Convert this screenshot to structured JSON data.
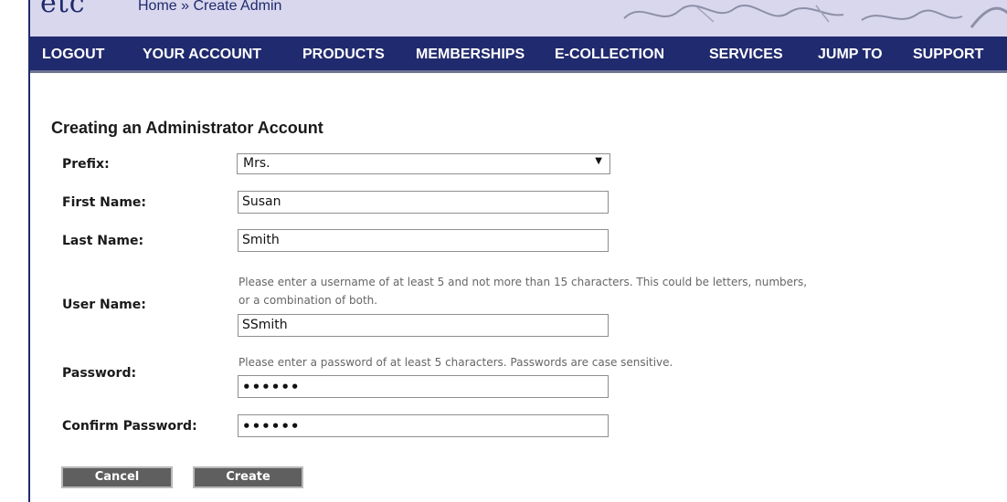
{
  "header": {
    "logo_text": "etc",
    "breadcrumb": "Home » Create Admin"
  },
  "nav": {
    "items": [
      "LOGOUT",
      "YOUR ACCOUNT",
      "PRODUCTS",
      "MEMBERSHIPS",
      "E-COLLECTION",
      "SERVICES",
      "JUMP TO",
      "SUPPORT"
    ]
  },
  "form": {
    "heading": "Creating an Administrator Account",
    "prefix": {
      "label": "Prefix:",
      "value": "Mrs."
    },
    "first_name": {
      "label": "First Name:",
      "value": "Susan"
    },
    "last_name": {
      "label": "Last Name:",
      "value": "Smith"
    },
    "user_name": {
      "label": "User Name:",
      "help_line1": "Please enter a username of at least 5 and not more than 15 characters. This could be letters, numbers,",
      "help_line2": "or a combination of both.",
      "value": "SSmith"
    },
    "password": {
      "label": "Password:",
      "help": "Please enter a password of at least 5 characters. Passwords are case sensitive.",
      "value": "••••••"
    },
    "confirm_password": {
      "label": "Confirm Password:",
      "value": "••••••"
    },
    "cancel_label": "Cancel",
    "create_label": "Create"
  },
  "colors": {
    "nav_bg": "#202a6e",
    "header_bg": "#d8d7ee",
    "button_bg": "#5f5f5f"
  }
}
